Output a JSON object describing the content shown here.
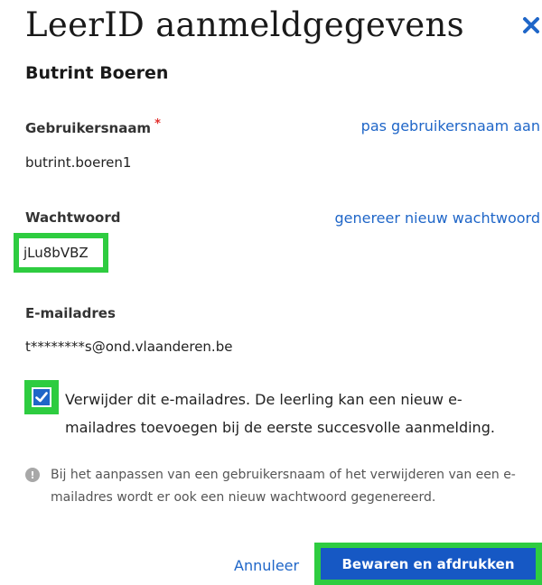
{
  "dialog": {
    "title": "LeerID aanmeldgegevens",
    "student_name": "Butrint Boeren"
  },
  "username": {
    "label": "Gebruikersnaam",
    "required_mark": "*",
    "edit_link": "pas gebruikersnaam aan",
    "value": "butrint.boeren1"
  },
  "password": {
    "label": "Wachtwoord",
    "generate_link": "genereer nieuw wachtwoord",
    "value": "jLu8bVBZ"
  },
  "email": {
    "label": "E-mailadres",
    "value": "t********s@ond.vlaanderen.be",
    "remove_checkbox": {
      "checked": true,
      "text": "Verwijder dit e-mailadres. De leerling kan een nieuw e-mailadres toevoegen bij de eerste succesvolle aanmelding."
    }
  },
  "info": {
    "icon": "info-icon",
    "text": "Bij het aanpassen van een gebruikersnaam of het verwijderen van een e-mailadres wordt er ook een nieuw wachtwoord gegenereerd."
  },
  "actions": {
    "cancel_label": "Annuleer",
    "save_label": "Bewaren en afdrukken"
  },
  "colors": {
    "accent": "#1f66c8",
    "primary_button": "#1658c4",
    "highlight": "#2ecc40",
    "required": "#e2302d"
  }
}
